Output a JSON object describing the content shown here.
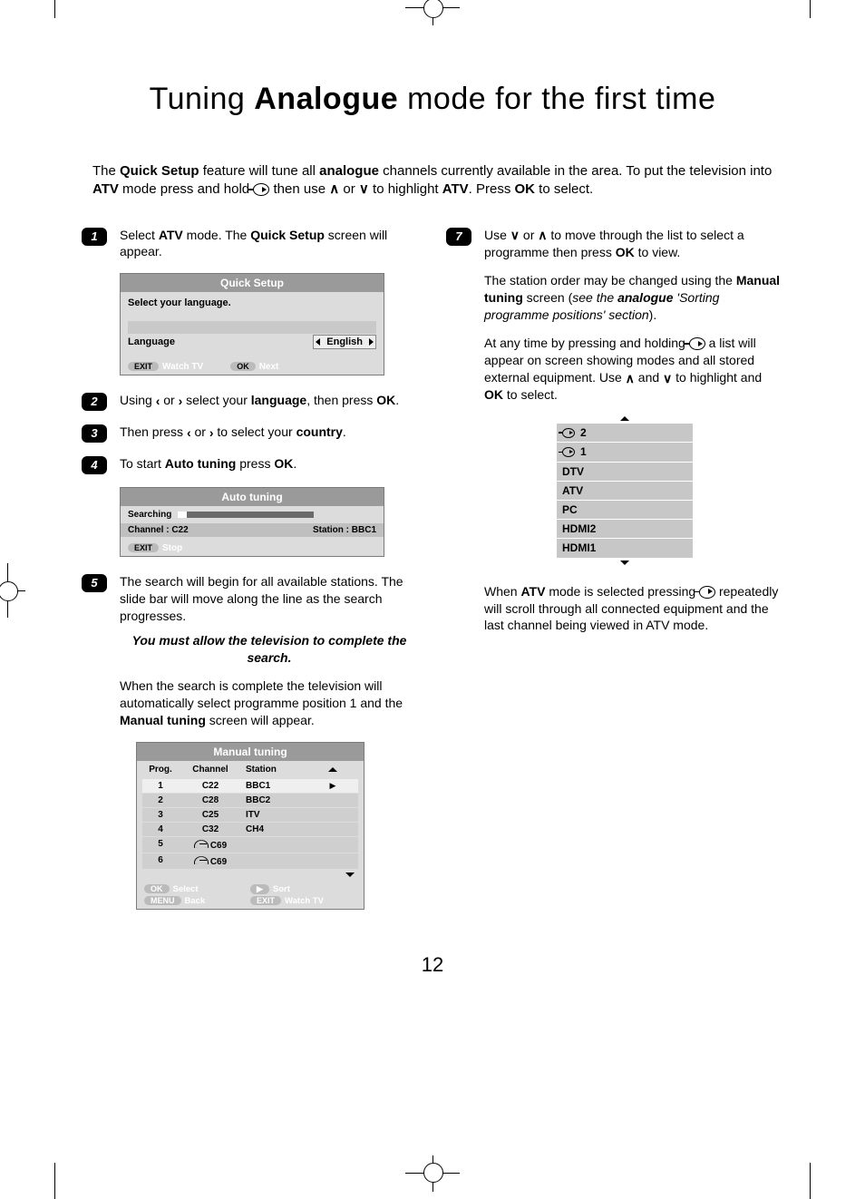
{
  "title": {
    "pre": "Tuning ",
    "bold": "Analogue",
    "post": " mode for the first time"
  },
  "intro": {
    "t1": "The ",
    "b1": "Quick Setup",
    "t2": " feature will tune all ",
    "b2": "analogue",
    "t3": " channels currently available in the area. To put the television into ",
    "b3": "ATV",
    "t4": " mode press and hold ",
    "t5": " then use ",
    "t6": " or ",
    "t7": " to highlight ",
    "b4": "ATV",
    "t8": ". Press ",
    "b5": "OK",
    "t9": " to select."
  },
  "steps": {
    "s1": {
      "a": "Select ",
      "b1": "ATV",
      "b": " mode. The ",
      "b2": "Quick Setup",
      "c": " screen will appear."
    },
    "s2": {
      "a": "Using ",
      "b": " or ",
      "c": " select your ",
      "bold": "language",
      "d": ", then press ",
      "bold2": "OK",
      "e": "."
    },
    "s3": {
      "a": "Then press ",
      "b": " or ",
      "c": " to select your ",
      "bold": "country",
      "d": "."
    },
    "s4": {
      "a": "To start ",
      "bold": "Auto tuning",
      "b": " press ",
      "bold2": "OK",
      "c": "."
    },
    "s5": {
      "a": "The search will begin for all available stations. The slide bar will move along the line as the search progresses."
    },
    "s5_emph": "You must allow the television to complete the search.",
    "s5_after_a": "When the search is complete the television will automatically select programme position 1 and the ",
    "s5_after_bold": "Manual tuning",
    "s5_after_b": " screen will appear.",
    "s7a": {
      "a": "Use ",
      "b": " or ",
      "c": " to move through the list to select a programme then press ",
      "bold": "OK",
      "d": " to view."
    },
    "s7b": {
      "a": "The station order may be changed using the ",
      "bold": "Manual tuning",
      "b": " screen (",
      "ital_a": "see the ",
      "ital_bold": "analogue",
      "ital_b": " 'Sorting programme positions' section",
      "c": ")."
    },
    "s7c": {
      "a": "At any time by pressing and holding ",
      "b": " a list will appear on screen showing modes and all stored external equipment. Use ",
      "c": " and ",
      "d": " to highlight and ",
      "bold": "OK",
      "e": " to select."
    },
    "s7d": {
      "a": "When ",
      "bold": "ATV",
      "b": " mode is selected pressing ",
      "c": " repeatedly will scroll through all connected equipment and the last channel being viewed in ATV mode."
    }
  },
  "osd_quick": {
    "title": "Quick Setup",
    "msg": "Select your language.",
    "label": "Language",
    "value": "English",
    "hint_exit": "EXIT",
    "hint_watch": "Watch TV",
    "hint_ok": "OK",
    "hint_next": "Next"
  },
  "osd_auto": {
    "title": "Auto tuning",
    "searching": "Searching",
    "chan_label": "Channel  :  C22",
    "stat_label": "Station : BBC1",
    "hint_exit": "EXIT",
    "hint_stop": "Stop"
  },
  "osd_manual": {
    "title": "Manual tuning",
    "head_prog": "Prog.",
    "head_chan": "Channel",
    "head_stat": "Station",
    "rows": [
      {
        "p": "1",
        "c": "C22",
        "s": "BBC1",
        "sel": true
      },
      {
        "p": "2",
        "c": "C28",
        "s": "BBC2"
      },
      {
        "p": "3",
        "c": "C25",
        "s": "ITV"
      },
      {
        "p": "4",
        "c": "C32",
        "s": "CH4"
      },
      {
        "p": "5",
        "c": "C69",
        "s": "",
        "scr": true
      },
      {
        "p": "6",
        "c": "C69",
        "s": "",
        "scr": true
      }
    ],
    "h_ok": "OK",
    "h_select": "Select",
    "h_sort": "Sort",
    "h_menu": "MENU",
    "h_back": "Back",
    "h_exit": "EXIT",
    "h_watch": "Watch TV"
  },
  "srclist": [
    "2",
    "1",
    "DTV",
    "ATV",
    "PC",
    "HDMI2",
    "HDMI1"
  ],
  "page_num": "12"
}
